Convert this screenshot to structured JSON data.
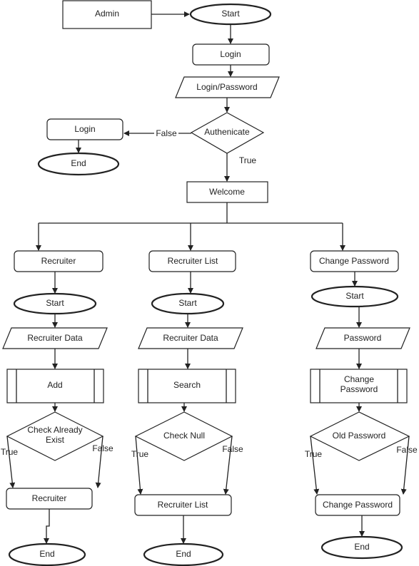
{
  "top": {
    "admin": "Admin",
    "start": "Start",
    "login": "Login",
    "login_password": "Login/Password",
    "authenticate": "Authenicate",
    "false_label": "False",
    "true_label": "True",
    "fail_login": "Login",
    "fail_end": "End",
    "welcome": "Welcome"
  },
  "columns": [
    {
      "title": "Recruiter",
      "start": "Start",
      "input": "Recruiter Data",
      "process": "Add",
      "decision_line1": "Check Already",
      "decision_line2": "Exist",
      "true_label": "True",
      "false_label": "False",
      "result": "Recruiter",
      "end": "End"
    },
    {
      "title": "Recruiter List",
      "start": "Start",
      "input": "Recruiter Data",
      "process": "Search",
      "decision_line1": "Check Null",
      "decision_line2": "",
      "true_label": "True",
      "false_label": "False",
      "result": "Recruiter List",
      "end": "End"
    },
    {
      "title": "Change Password",
      "start": "Start",
      "input": "Password",
      "process_line1": "Change",
      "process_line2": "Password",
      "decision_line1": "Old Password",
      "decision_line2": "",
      "true_label": "True",
      "false_label": "False",
      "result": "Change Password",
      "end": "End"
    }
  ]
}
